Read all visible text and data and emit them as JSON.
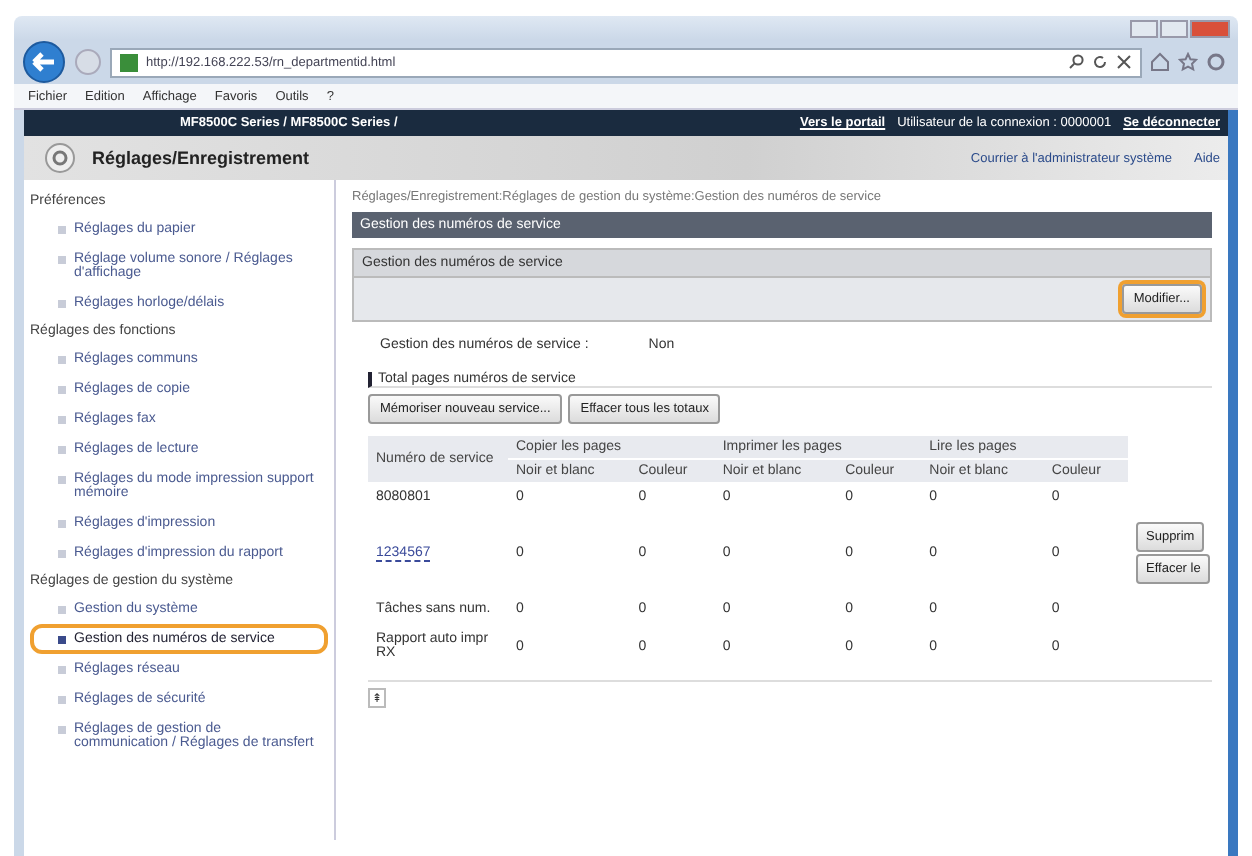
{
  "browser": {
    "url": "http://192.168.222.53/rn_departmentid.html",
    "menu": [
      "Fichier",
      "Edition",
      "Affichage",
      "Favoris",
      "Outils",
      "?"
    ]
  },
  "header": {
    "device": "MF8500C Series / MF8500C Series /",
    "portal_link": "Vers le portail",
    "user": "Utilisateur de la connexion : 0000001",
    "logout": "Se déconnecter"
  },
  "title_bar": {
    "title": "Réglages/Enregistrement",
    "links": [
      "Courrier à l'administrateur système",
      "Aide"
    ]
  },
  "sidebar": [
    {
      "heading": "Préférences",
      "items": [
        {
          "label": "Réglages du papier",
          "selected": false,
          "highlighted": false
        },
        {
          "label": "Réglage volume sonore / Réglages d'affichage",
          "selected": false,
          "highlighted": false
        },
        {
          "label": "Réglages horloge/délais",
          "selected": false,
          "highlighted": false
        }
      ]
    },
    {
      "heading": "Réglages des fonctions",
      "items": [
        {
          "label": "Réglages communs",
          "selected": false,
          "highlighted": false
        },
        {
          "label": "Réglages de copie",
          "selected": false,
          "highlighted": false
        },
        {
          "label": "Réglages fax",
          "selected": false,
          "highlighted": false
        },
        {
          "label": "Réglages de lecture",
          "selected": false,
          "highlighted": false
        },
        {
          "label": "Réglages du mode impression support mémoire",
          "selected": false,
          "highlighted": false
        },
        {
          "label": "Réglages d'impression",
          "selected": false,
          "highlighted": false
        },
        {
          "label": "Réglages d'impression du rapport",
          "selected": false,
          "highlighted": false
        }
      ]
    },
    {
      "heading": "Réglages de gestion du système",
      "items": [
        {
          "label": "Gestion du système",
          "selected": false,
          "highlighted": false
        },
        {
          "label": "Gestion des numéros de service",
          "selected": true,
          "highlighted": true
        },
        {
          "label": "Réglages réseau",
          "selected": false,
          "highlighted": false
        },
        {
          "label": "Réglages de sécurité",
          "selected": false,
          "highlighted": false
        },
        {
          "label": "Réglages de gestion de communication / Réglages de transfert",
          "selected": false,
          "highlighted": false
        }
      ]
    }
  ],
  "main": {
    "breadcrumb": "Réglages/Enregistrement:Réglages de gestion du système:Gestion des numéros de service",
    "section_title": "Gestion des numéros de service",
    "panel": {
      "title": "Gestion des numéros de service",
      "button": {
        "label": "Modifier...",
        "highlighted": true
      }
    },
    "setting": {
      "label": "Gestion des numéros de service :",
      "value": "Non"
    },
    "subsection": "Total pages numéros de service",
    "buttons": [
      "Mémoriser nouveau service...",
      "Effacer tous les totaux"
    ],
    "table": {
      "first_column": "Numéro de service",
      "groups": [
        "Copier les pages",
        "Imprimer les pages",
        "Lire les pages"
      ],
      "subcolumns": [
        "Noir et blanc",
        "Couleur",
        "Noir et blanc",
        "Couleur",
        "Noir et blanc",
        "Couleur"
      ],
      "rows": [
        {
          "name": "8080801",
          "kind": "text",
          "values": [
            "0",
            "0",
            "0",
            "0",
            "0",
            "0"
          ],
          "actions": []
        },
        {
          "name": "1234567",
          "kind": "link",
          "values": [
            "0",
            "0",
            "0",
            "0",
            "0",
            "0"
          ],
          "actions": [
            "Supprim",
            "Effacer le"
          ]
        },
        {
          "name": "Tâches sans num.",
          "kind": "text",
          "values": [
            "0",
            "0",
            "0",
            "0",
            "0",
            "0"
          ],
          "actions": []
        },
        {
          "name": "Rapport auto impr RX",
          "kind": "text",
          "values": [
            "0",
            "0",
            "0",
            "0",
            "0",
            "0"
          ],
          "actions": []
        }
      ]
    },
    "top_link": "⇞"
  }
}
